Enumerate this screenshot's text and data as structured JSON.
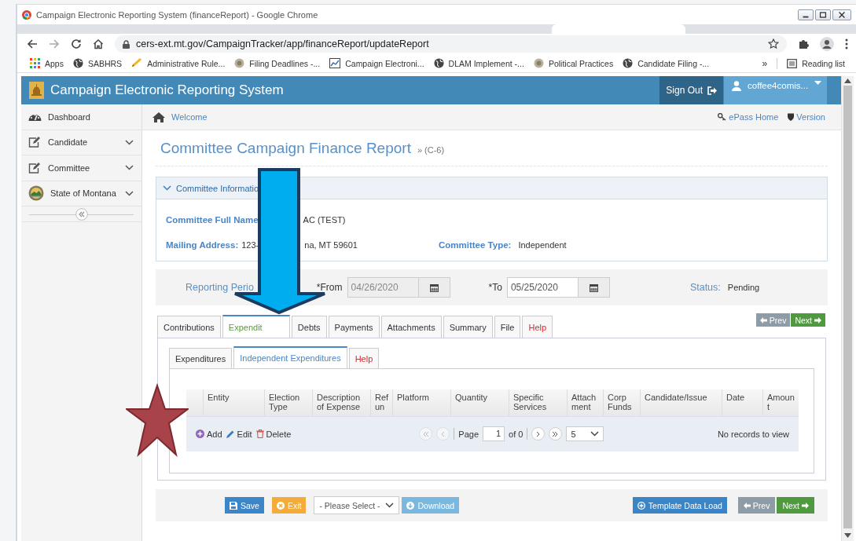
{
  "browser": {
    "title": "Campaign Electronic Reporting System (financeReport) - Google Chrome",
    "url": "cers-ext.mt.gov/CampaignTracker/app/financeReport/updateReport",
    "bookmarks": [
      {
        "label": "Apps",
        "kind": "apps"
      },
      {
        "label": "SABHRS",
        "kind": "globe"
      },
      {
        "label": "Administrative Rule...",
        "kind": "pencil"
      },
      {
        "label": "Filing Deadlines -...",
        "kind": "emblem"
      },
      {
        "label": "Campaign Electroni...",
        "kind": "page"
      },
      {
        "label": "DLAM Implement -...",
        "kind": "globe"
      },
      {
        "label": "Political Practices",
        "kind": "emblem"
      },
      {
        "label": "Candidate Filing -...",
        "kind": "globe"
      }
    ],
    "more": "»",
    "reading_list": "Reading list"
  },
  "app": {
    "title": "Campaign Electronic Reporting System",
    "sign_out": "Sign Out",
    "user": "coffee4comis..."
  },
  "sidebar": {
    "items": [
      {
        "label": "Dashboard",
        "kind": "dashboard",
        "submenu": false
      },
      {
        "label": "Candidate",
        "kind": "edit",
        "submenu": true
      },
      {
        "label": "Committee",
        "kind": "edit",
        "submenu": true
      },
      {
        "label": "State of Montana",
        "kind": "seal",
        "submenu": true
      }
    ]
  },
  "breadcrumb": {
    "home": "Welcome",
    "links": [
      {
        "label": "ePass Home",
        "kind": "key"
      },
      {
        "label": "Version",
        "kind": "shield"
      }
    ]
  },
  "page": {
    "title": "Committee Campaign Finance Report",
    "form": "» (C-6)"
  },
  "committee_info": {
    "heading": "Committee Informatio",
    "full_name_label": "Committee Full Name",
    "full_name_value": "AC (TEST)",
    "mailing_label": "Mailing Address:",
    "mailing_value_start": "123-",
    "mailing_value_end": "na, MT 59601",
    "type_label": "Committee Type:",
    "type_value": "Independent"
  },
  "reporting_period": {
    "label": "Reporting Perio",
    "from_label": "*From",
    "from": "04/26/2020",
    "from_disabled": true,
    "to_label": "*To",
    "to": "05/25/2020",
    "to_disabled": false,
    "status_label": "Status:",
    "status": "Pending"
  },
  "tabs": [
    {
      "label": "Contributions",
      "selected": false,
      "kind": "normal"
    },
    {
      "label": "Expendit",
      "selected": true,
      "kind": "normal"
    },
    {
      "label": "Debts",
      "selected": false,
      "kind": "normal"
    },
    {
      "label": "Payments",
      "selected": false,
      "kind": "normal"
    },
    {
      "label": "Attachments",
      "selected": false,
      "kind": "normal"
    },
    {
      "label": "Summary",
      "selected": false,
      "kind": "normal"
    },
    {
      "label": "File",
      "selected": false,
      "kind": "normal"
    },
    {
      "label": "Help",
      "selected": false,
      "kind": "help"
    }
  ],
  "step_buttons": [
    {
      "label": "Prev",
      "kind": "prev",
      "disabled": true
    },
    {
      "label": "Next",
      "kind": "next",
      "disabled": false
    }
  ],
  "subtabs": [
    {
      "label": "Expenditures",
      "selected": false,
      "kind": "normal"
    },
    {
      "label": "Independent Expenditures",
      "selected": true,
      "kind": "normal"
    },
    {
      "label": "Help",
      "selected": false,
      "kind": "help"
    }
  ],
  "grid": {
    "columns": [
      "Entity",
      "Election Type",
      "Description of Expense",
      "Refun",
      "Platform",
      "Quantity",
      "Specific Services",
      "Attachment",
      "Corp Funds",
      "Candidate/Issue",
      "Date",
      "Amount"
    ],
    "actions": [
      {
        "label": "Add",
        "kind": "add"
      },
      {
        "label": "Edit",
        "kind": "edit"
      },
      {
        "label": "Delete",
        "kind": "delete"
      }
    ],
    "pager": {
      "page_label": "Page",
      "page": "1",
      "of": "of 0",
      "page_size": "5"
    },
    "empty": "No records to view"
  },
  "footer": {
    "buttons": [
      {
        "label": "Save",
        "kind": "save"
      },
      {
        "label": "Exit",
        "kind": "exit"
      },
      {
        "label": "- Please Select -",
        "kind": "select"
      },
      {
        "label": "Download",
        "kind": "download"
      }
    ],
    "template": "Template Data Load",
    "step_buttons": [
      {
        "label": "Prev",
        "kind": "prev",
        "disabled": true
      },
      {
        "label": "Next",
        "kind": "next",
        "disabled": false
      }
    ]
  }
}
